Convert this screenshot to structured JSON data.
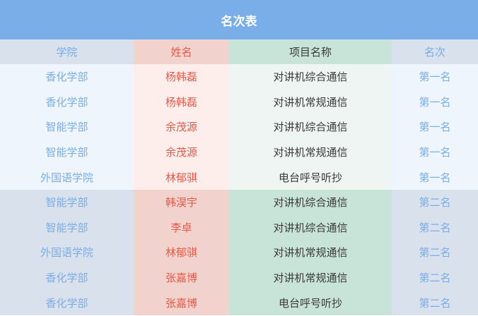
{
  "title": "名次表",
  "headers": {
    "college": "学院",
    "name": "姓名",
    "project": "项目名称",
    "rank": "名次"
  },
  "rows": [
    {
      "college": "香化学部",
      "name": "杨韩磊",
      "project": "对讲机综合通信",
      "rank": "第一名"
    },
    {
      "college": "香化学部",
      "name": "杨韩磊",
      "project": "对讲机常规通信",
      "rank": "第一名"
    },
    {
      "college": "智能学部",
      "name": "余茂源",
      "project": "对讲机综合通信",
      "rank": "第一名"
    },
    {
      "college": "智能学部",
      "name": "余茂源",
      "project": "对讲机常规通信",
      "rank": "第一名"
    },
    {
      "college": "外国语学院",
      "name": "林郁骐",
      "project": "电台呼号听抄",
      "rank": "第一名"
    },
    {
      "college": "智能学部",
      "name": "韩淏宇",
      "project": "对讲机综合通信",
      "rank": "第二名"
    },
    {
      "college": "智能学部",
      "name": "李卓",
      "project": "对讲机综合通信",
      "rank": "第二名"
    },
    {
      "college": "外国语学院",
      "name": "林郁骐",
      "project": "对讲机常规通信",
      "rank": "第二名"
    },
    {
      "college": "香化学部",
      "name": "张嘉博",
      "project": "对讲机常规通信",
      "rank": "第二名"
    },
    {
      "college": "香化学部",
      "name": "张嘉博",
      "project": "电台呼号听抄",
      "rank": "第二名"
    }
  ],
  "colors": {
    "title_bar": "#7aaee8",
    "college_text": "#7aaee8",
    "name_text": "#e65a48",
    "project_text": "#3a3a3a"
  }
}
